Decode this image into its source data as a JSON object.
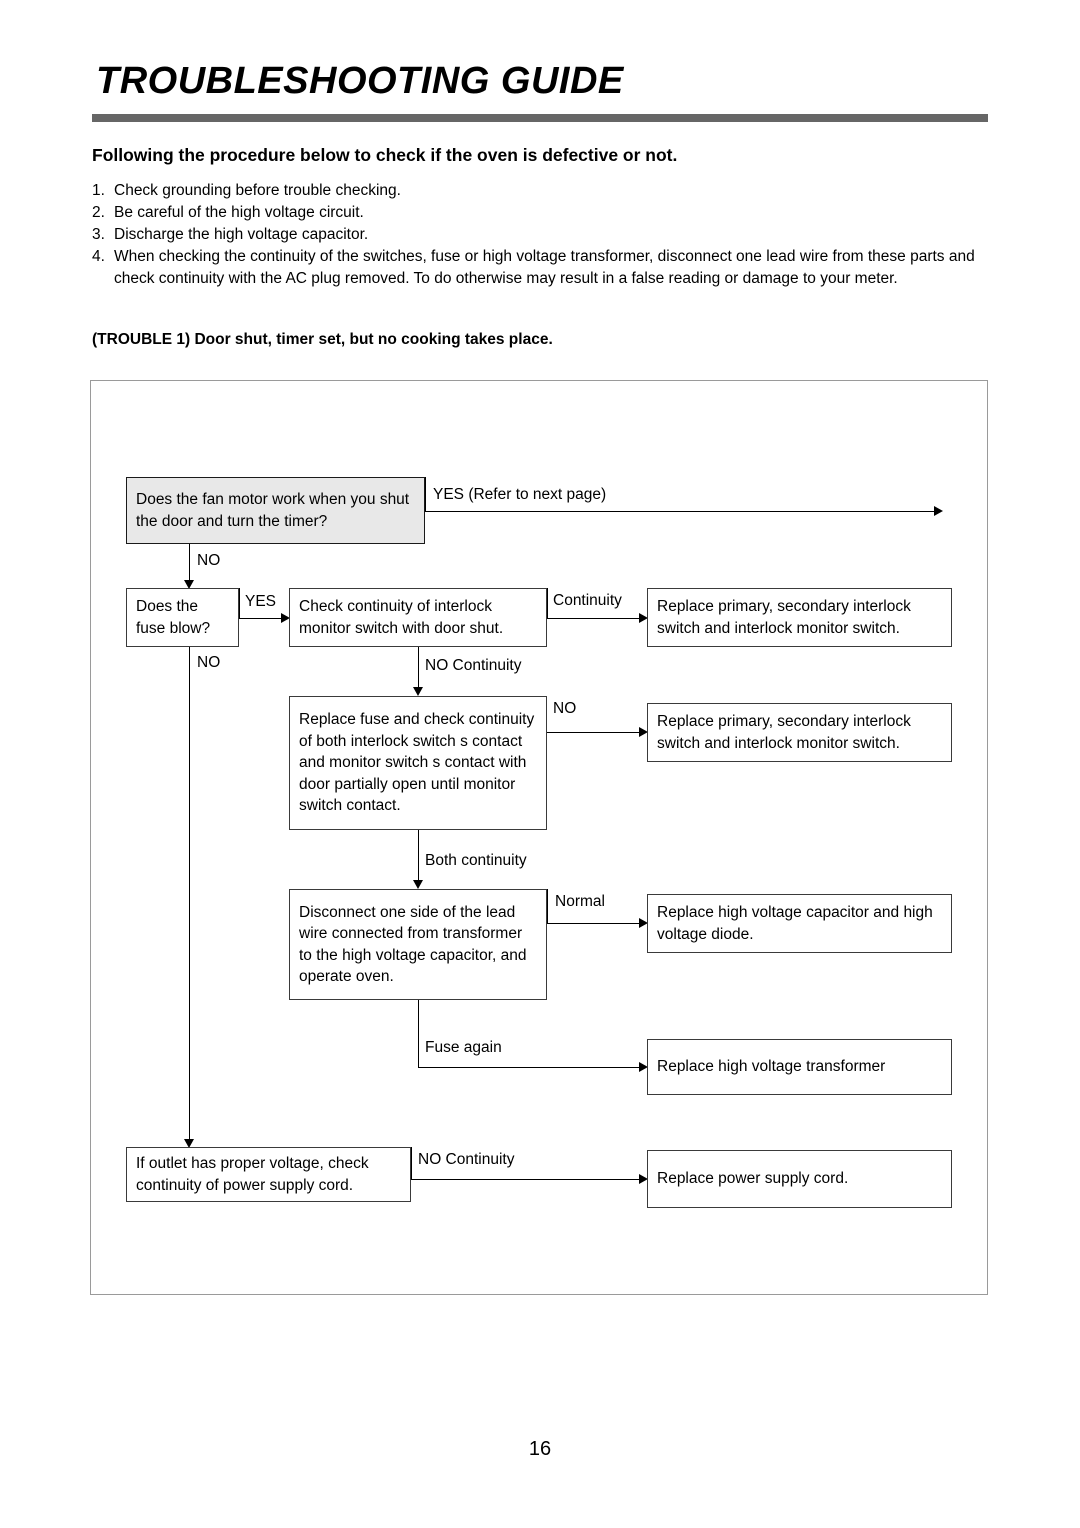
{
  "document": {
    "title": "TROUBLESHOOTING GUIDE",
    "page_number": "16",
    "intro_heading": "Following the procedure below to check if the oven is defective or not.",
    "intro_items": [
      {
        "num": "1.",
        "text": "Check grounding before trouble checking."
      },
      {
        "num": "2.",
        "text": "Be careful of the high voltage circuit."
      },
      {
        "num": "3.",
        "text": "Discharge the high voltage capacitor."
      },
      {
        "num": "4.",
        "text": "When checking the continuity of the switches, fuse or high voltage transformer, disconnect one lead wire from these parts and check continuity with the AC plug removed. To do otherwise may result in a false reading or damage to your meter."
      }
    ],
    "trouble_heading": "(TROUBLE 1)  Door shut, timer set, but no cooking takes place."
  },
  "flowchart": {
    "nodes": {
      "fan_motor_question": "Does the fan motor work when you shut the door and turn the timer?",
      "fuse_blow_question": "Does the fuse blow?",
      "check_interlock_monitor": "Check continuity of interlock monitor switch with door shut.",
      "replace_interlock_1": "Replace primary, secondary interlock switch and interlock monitor switch.",
      "replace_fuse_check": "Replace fuse and check continuity of both interlock switch s contact and monitor switch s contact with door partially open until monitor switch contact.",
      "replace_interlock_2": "Replace primary, secondary interlock switch and interlock monitor switch.",
      "disconnect_lead_wire": "Disconnect one side of the lead wire connected from transformer to the high voltage capacitor, and operate oven.",
      "replace_capacitor_diode": "Replace high voltage capacitor and high voltage diode.",
      "replace_transformer": "Replace high voltage transformer",
      "check_outlet_voltage": "If outlet has proper voltage, check continuity of power supply cord.",
      "replace_power_cord": "Replace power supply cord."
    },
    "edge_labels": {
      "yes_next_page": "YES (Refer to next page)",
      "no_fan": "NO",
      "yes_fuse": "YES",
      "continuity": "Continuity",
      "no_fuse": "NO",
      "no_continuity_1": "NO Continuity",
      "no_interlock": "NO",
      "both_continuity": "Both continuity",
      "normal": "Normal",
      "fuse_again": "Fuse again",
      "no_continuity_2": "NO Continuity"
    }
  },
  "colors": {
    "rule": "#666666",
    "shaded_node": "#e8e8e8",
    "frame_border": "#9a9a9a",
    "node_border": "#3a3a3a"
  }
}
